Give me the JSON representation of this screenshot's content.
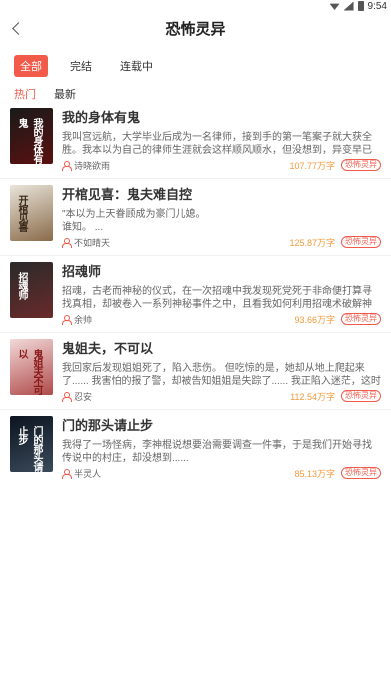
{
  "status_bar": {
    "time": "9:54"
  },
  "header": {
    "title": "恐怖灵异"
  },
  "filters": [
    {
      "label": "全部",
      "active": true
    },
    {
      "label": "完结",
      "active": false
    },
    {
      "label": "连载中",
      "active": false
    }
  ],
  "sorts": [
    {
      "label": "热门",
      "active": true
    },
    {
      "label": "最新",
      "active": false
    }
  ],
  "books": [
    {
      "title": "我的身体有鬼",
      "desc": "我叫宫远航，大学毕业后成为一名律师，接到手的第一笔案子就大获全胜。我本以为自己的律师生涯就会这样顺风顺水，但没想到，异变早已经在我身边...",
      "author": "诗晓欲雨",
      "words": "107.77万字",
      "tag": "恐怖灵异",
      "cover_text": "我的身体有鬼",
      "cover_colors": [
        "#1a1a1a",
        "#5a1010"
      ]
    },
    {
      "title": "开棺见喜：鬼夫难自控",
      "desc": "\"本以为上天眷顾成为豪门儿媳。\n谁知。 ...",
      "author": "不如晴天",
      "words": "125.87万字",
      "tag": "恐怖灵异",
      "cover_text": "开棺见喜",
      "cover_colors": [
        "#e9e4da",
        "#8a6b4a"
      ]
    },
    {
      "title": "招魂师",
      "desc": "招魂，古老而神秘的仪式，在一次招魂中我发现死党死于非命便打算寻找真相，却被卷入一系列神秘事件之中，且看我如何利用招魂术破解神秘案件。",
      "author": "余帅",
      "words": "93.66万字",
      "tag": "恐怖灵异",
      "cover_text": "招魂师",
      "cover_colors": [
        "#2a2a2a",
        "#6a2a2a"
      ]
    },
    {
      "title": "鬼姐夫，不可以",
      "desc": "我回家后发现姐姐死了，陷入悲伤。 但吃惊的是，她却从地上爬起来了...... 我害怕的报了警，却被告知姐姐是失踪了...... 我正陷入迷茫，这时有个自称姐...",
      "author": "忍安",
      "words": "112.54万字",
      "tag": "恐怖灵异",
      "cover_text": "鬼姐夫不可以",
      "cover_colors": [
        "#f2d9d9",
        "#b04a4a"
      ]
    },
    {
      "title": "门的那头请止步",
      "desc": "我得了一场怪病，李神棍说想要治需要调查一件事，于是我们开始寻找传说中的村庄，却没想到......",
      "author": "半灵人",
      "words": "85.13万字",
      "tag": "恐怖灵异",
      "cover_text": "门的那头请止步",
      "cover_colors": [
        "#0c1420",
        "#3a4a5a"
      ]
    }
  ]
}
